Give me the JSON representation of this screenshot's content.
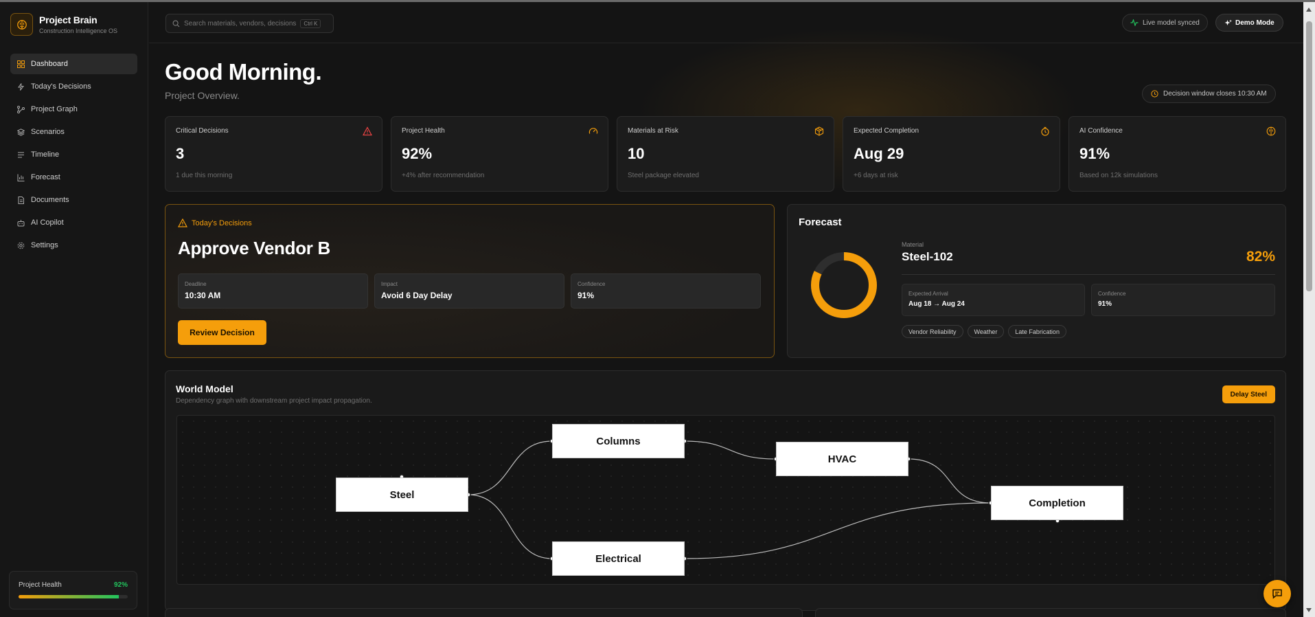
{
  "brand": {
    "title": "Project Brain",
    "subtitle": "Construction Intelligence OS",
    "logo_icon": "brain-icon"
  },
  "nav": {
    "items": [
      {
        "label": "Dashboard",
        "icon": "grid-icon",
        "active": true
      },
      {
        "label": "Today's Decisions",
        "icon": "spark-icon"
      },
      {
        "label": "Project Graph",
        "icon": "graph-icon"
      },
      {
        "label": "Scenarios",
        "icon": "layers-icon"
      },
      {
        "label": "Timeline",
        "icon": "list-icon"
      },
      {
        "label": "Forecast",
        "icon": "bar-chart-icon"
      },
      {
        "label": "Documents",
        "icon": "document-icon"
      },
      {
        "label": "AI Copilot",
        "icon": "bot-icon"
      },
      {
        "label": "Settings",
        "icon": "gear-icon"
      }
    ]
  },
  "sidebar_health": {
    "label": "Project Health",
    "value": "92%",
    "fill": 0.92
  },
  "search": {
    "placeholder": "Search materials, vendors, decisions",
    "shortcut": "Ctrl K"
  },
  "topbar": {
    "sync_label": "Live model synced",
    "demo_label": "Demo Mode"
  },
  "greeting": {
    "title": "Good Morning.",
    "subtitle": "Project Overview.",
    "window_label": "Decision window closes 10:30 AM"
  },
  "stats": [
    {
      "label": "Critical Decisions",
      "value": "3",
      "sub": "1 due this morning",
      "icon": "alert-triangle-icon",
      "color": "#ef4444"
    },
    {
      "label": "Project Health",
      "value": "92%",
      "sub": "+4% after recommendation",
      "icon": "gauge-icon",
      "color": "#f59e0b"
    },
    {
      "label": "Materials at Risk",
      "value": "10",
      "sub": "Steel package elevated",
      "icon": "package-icon",
      "color": "#f59e0b"
    },
    {
      "label": "Expected Completion",
      "value": "Aug 29",
      "sub": "+6 days at risk",
      "icon": "timer-icon",
      "color": "#f59e0b"
    },
    {
      "label": "AI Confidence",
      "value": "91%",
      "sub": "Based on 12k simulations",
      "icon": "brain-icon",
      "color": "#f59e0b"
    }
  ],
  "decision": {
    "tag": "Today's Decisions",
    "title": "Approve Vendor B",
    "boxes": [
      {
        "label": "Deadline",
        "value": "10:30 AM"
      },
      {
        "label": "Impact",
        "value": "Avoid 6 Day Delay"
      },
      {
        "label": "Confidence",
        "value": "91%"
      }
    ],
    "button": "Review Decision"
  },
  "forecast": {
    "title": "Forecast",
    "material_label": "Material",
    "material": "Steel-102",
    "percent": "82%",
    "percent_value": 0.82,
    "arrival_label": "Expected Arrival",
    "arrival": "Aug 18 → Aug 24",
    "confidence_label": "Confidence",
    "confidence": "91%",
    "tags": [
      "Vendor Reliability",
      "Weather",
      "Late Fabrication"
    ],
    "accent": "#f59e0b"
  },
  "world_model": {
    "title": "World Model",
    "subtitle": "Dependency graph with downstream project impact propagation.",
    "button": "Delay Steel",
    "nodes": [
      "Steel",
      "Columns",
      "Electrical",
      "HVAC",
      "Completion"
    ]
  }
}
